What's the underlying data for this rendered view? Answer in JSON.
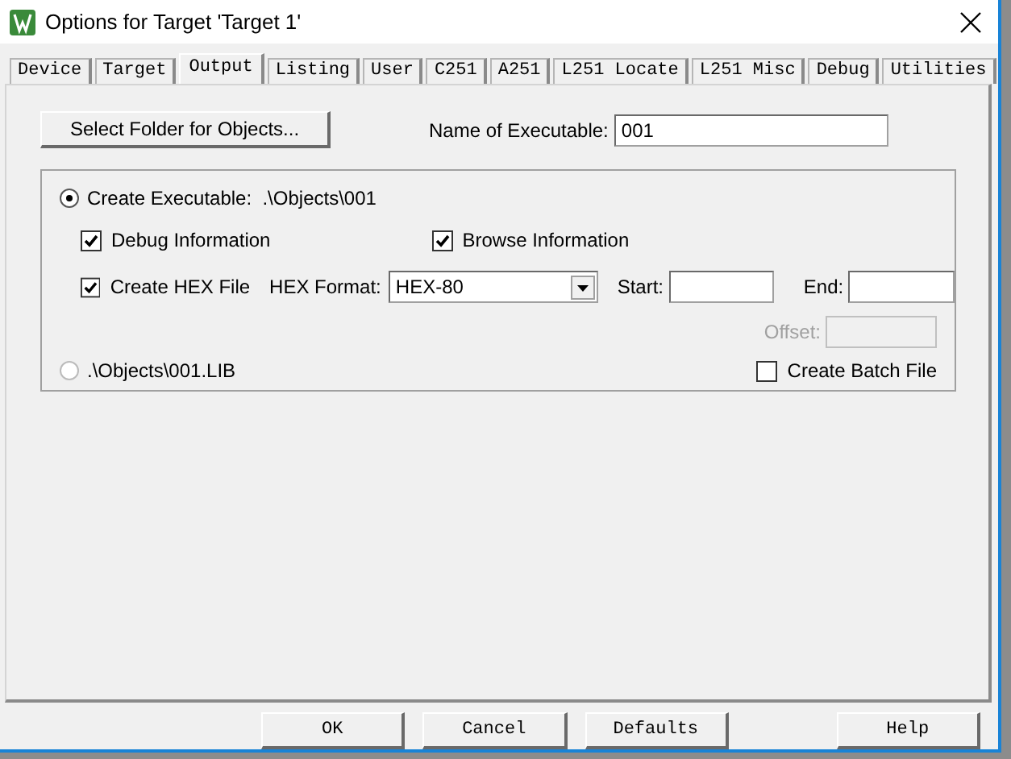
{
  "window": {
    "title": "Options for Target 'Target 1'"
  },
  "tabs": [
    {
      "label": "Device",
      "selected": false
    },
    {
      "label": "Target",
      "selected": false
    },
    {
      "label": "Output",
      "selected": true
    },
    {
      "label": "Listing",
      "selected": false
    },
    {
      "label": "User",
      "selected": false
    },
    {
      "label": "C251",
      "selected": false
    },
    {
      "label": "A251",
      "selected": false
    },
    {
      "label": "L251 Locate",
      "selected": false
    },
    {
      "label": "L251 Misc",
      "selected": false
    },
    {
      "label": "Debug",
      "selected": false
    },
    {
      "label": "Utilities",
      "selected": false
    }
  ],
  "output": {
    "select_folder_button": "Select Folder for Objects...",
    "name_label": "Name of Executable:",
    "name_value": "001",
    "create_executable": {
      "label": "Create Executable:  .\\Objects\\001",
      "selected": true
    },
    "options": [
      {
        "label": "Debug Information",
        "checked": true
      },
      {
        "label": "Browse Information",
        "checked": true
      }
    ],
    "create_hex": {
      "label": "Create HEX File",
      "checked": true
    },
    "hex_format": {
      "label": "HEX Format:",
      "value": "HEX-80"
    },
    "start": {
      "label": "Start:"
    },
    "end": {
      "label": "End:"
    },
    "offset": {
      "label": "Offset:",
      "disabled": true
    },
    "create_library": {
      "label": ".\\Objects\\001.LIB",
      "selected": false
    },
    "create_batch": {
      "label": "Create Batch File",
      "checked": false
    }
  },
  "buttons": [
    "OK",
    "Cancel",
    "Defaults",
    "Help"
  ]
}
